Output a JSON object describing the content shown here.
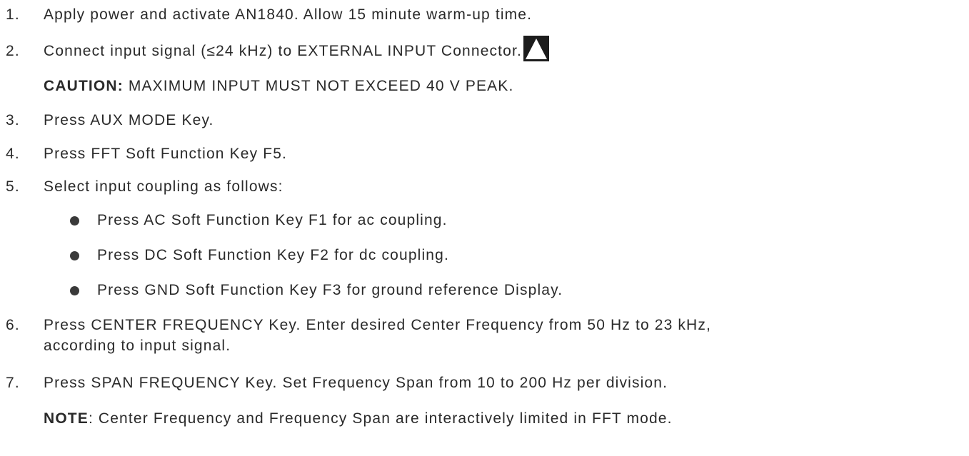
{
  "steps": [
    {
      "num": "1.",
      "text": "Apply power and activate AN1840.  Allow 15 minute warm-up time."
    },
    {
      "num": "2.",
      "text": "Connect input signal (≤24 kHz) to EXTERNAL INPUT Connector."
    },
    {
      "num": "3.",
      "text": "Press AUX MODE Key."
    },
    {
      "num": "4.",
      "text": "Press FFT Soft Function Key F5."
    },
    {
      "num": "5.",
      "text": "Select input coupling as follows:"
    },
    {
      "num": "6.",
      "text": "Press CENTER FREQUENCY Key.  Enter desired Center Frequency from 50 Hz to 23 kHz,",
      "text2": "according to input signal."
    },
    {
      "num": "7.",
      "text": "Press SPAN FREQUENCY Key.  Set Frequency Span from 10 to 200 Hz per division."
    }
  ],
  "caution": {
    "label": "CAUTION:",
    "text": "  MAXIMUM INPUT MUST NOT EXCEED 40 V PEAK."
  },
  "bullets": [
    "Press AC Soft Function Key F1 for ac coupling.",
    "Press DC Soft Function Key F2 for dc coupling.",
    "Press GND Soft Function Key F3 for ground reference Display."
  ],
  "note": {
    "label": "NOTE",
    "text": ":  Center Frequency and Frequency Span are interactively limited in FFT mode."
  },
  "icons": {
    "warning": "warning-triangle-icon"
  }
}
